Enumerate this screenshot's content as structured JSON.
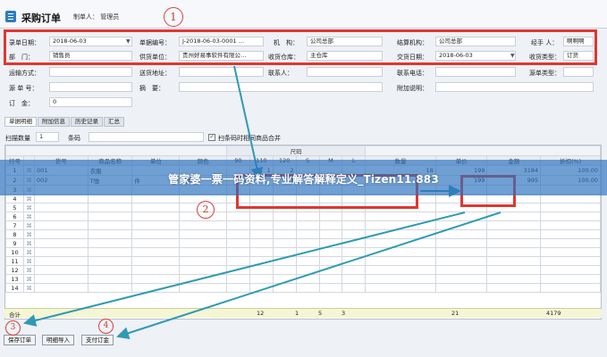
{
  "title": "采购订单",
  "creator": "制单人：  管理员",
  "annotations": [
    "1",
    "2",
    "3",
    "4"
  ],
  "header": {
    "row1": [
      {
        "label": "录单日期：",
        "value": "2018-06-03"
      },
      {
        "label": "单据编号：",
        "value": "J-2018-06-03-0001 …"
      },
      {
        "label": "机　构：",
        "value": "公司总部"
      },
      {
        "label": "结算机构：",
        "value": "公司总部"
      },
      {
        "label": "经手 人：",
        "value": "啊啊啊"
      }
    ],
    "row2": [
      {
        "label": "部　门：",
        "value": "销售员"
      },
      {
        "label": "供货单位：",
        "value": "贵州好易事软件有限公…"
      },
      {
        "label": "收货仓库：",
        "value": "主仓库"
      },
      {
        "label": "交货日期：",
        "value": "2018-06-03"
      },
      {
        "label": "收货类型：",
        "value": "订货"
      }
    ],
    "row3": [
      "运输方式：",
      "送货地址：",
      "联系人：",
      "联系电话：",
      "源单类型："
    ],
    "row4": [
      "源 单 号：",
      "摘　要：",
      "附加说明："
    ],
    "row5": {
      "label": "订　金：",
      "value": "0"
    }
  },
  "tabs": [
    "单据明细",
    "附加信息",
    "历史记录",
    "汇总"
  ],
  "scanbar": {
    "qty_label": "扫描数量",
    "qty_value": "1",
    "barcode_label": "条码",
    "merge_label": "扫条码时相同商品合并",
    "merge_mark": "✓"
  },
  "grid": {
    "size_group": "尺码",
    "columns": [
      "行号",
      "货号",
      "商品名称",
      "单位",
      "颜色",
      "90",
      "110",
      "120",
      "S",
      "M",
      "L",
      "数量",
      "单价",
      "金额",
      "折扣(%)"
    ],
    "rows": [
      {
        "no": "1",
        "code": "001",
        "name": "衣服",
        "unit": "",
        "color": "",
        "s90": "",
        "s110": "1",
        "s120": "2",
        "sS": "",
        "sM": "",
        "sL": "",
        "qty": "18",
        "price": "199",
        "amount": "3184",
        "discount": "100.00"
      },
      {
        "no": "2",
        "code": "002",
        "name": "T恤",
        "unit": "件",
        "color": "均色",
        "s90": "2",
        "s110": "",
        "s120": "3",
        "sS": "",
        "sM": "",
        "sL": "",
        "qty": "5",
        "price": "199",
        "amount": "995",
        "discount": "100.00"
      },
      {
        "no": "3"
      },
      {
        "no": "4"
      },
      {
        "no": "5"
      },
      {
        "no": "6"
      },
      {
        "no": "7"
      },
      {
        "no": "8"
      },
      {
        "no": "9"
      },
      {
        "no": "10"
      },
      {
        "no": "11"
      },
      {
        "no": "12"
      },
      {
        "no": "13"
      },
      {
        "no": "14"
      }
    ],
    "summary": {
      "label": "合计",
      "s90": "12",
      "s110": "1",
      "s120": "5",
      "sS": "3",
      "qty": "21",
      "amount": "4179"
    }
  },
  "buttons": {
    "save": "保存订单",
    "import": "明细导入",
    "pay": "支付订金"
  },
  "banner": "管家婆一票一码资料,专业解答解释定义_Tizen11.883",
  "colors": {
    "annotation_red": "#e0362f",
    "arrow_teal": "#2f9ab5",
    "banner_blue": "#2c71be"
  }
}
